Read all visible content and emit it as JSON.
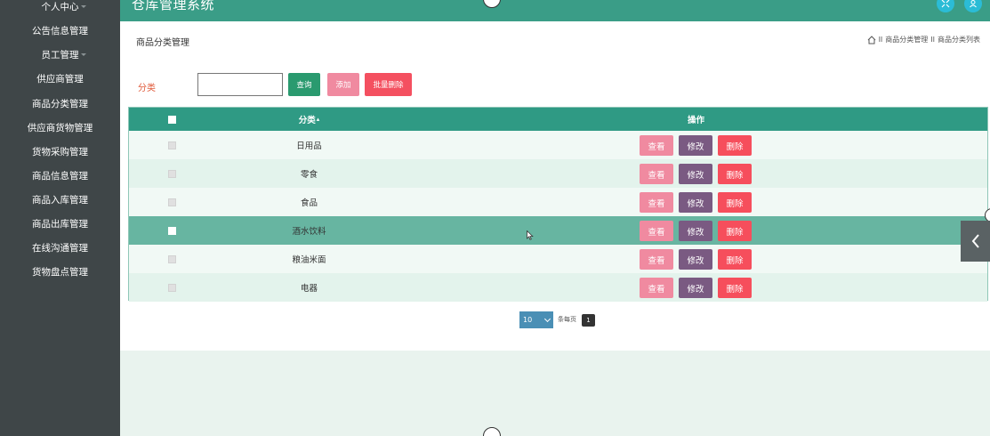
{
  "app": {
    "title": "仓库管理系统"
  },
  "sidebar": {
    "items": [
      {
        "label": "个人中心"
      },
      {
        "label": "公告信息管理"
      },
      {
        "label": "员工管理"
      },
      {
        "label": "供应商管理"
      },
      {
        "label": "商品分类管理"
      },
      {
        "label": "供应商货物管理"
      },
      {
        "label": "货物采购管理"
      },
      {
        "label": "商品信息管理"
      },
      {
        "label": "商品入库管理"
      },
      {
        "label": "商品出库管理"
      },
      {
        "label": "在线沟通管理"
      },
      {
        "label": "货物盘点管理"
      }
    ]
  },
  "page": {
    "title": "商品分类管理",
    "breadcrumb": [
      "商品分类管理",
      "商品分类列表"
    ],
    "breadcrumb_sep": "II"
  },
  "search": {
    "label": "分类",
    "value": "",
    "placeholder": "",
    "search_button": "查询",
    "add_button": "添加",
    "batch_delete_button": "批量删除"
  },
  "table": {
    "headers": {
      "category": "分类",
      "actions": "操作"
    },
    "rows": [
      {
        "category": "日用品"
      },
      {
        "category": "零食"
      },
      {
        "category": "食品"
      },
      {
        "category": "酒水饮料"
      },
      {
        "category": "粮油米面"
      },
      {
        "category": "电器"
      }
    ],
    "actions": {
      "view": "查看",
      "edit": "修改",
      "delete": "删除"
    },
    "active_row": 3
  },
  "pagination": {
    "page_size": "10",
    "per_page_label": "条每页",
    "current_page": "1"
  },
  "colors": {
    "sidebar": "#3f4648",
    "header": "#3a9d87",
    "table_header": "#2f9a84",
    "view": "#f08aa0",
    "edit": "#7a5a82",
    "delete": "#f64e5c"
  }
}
